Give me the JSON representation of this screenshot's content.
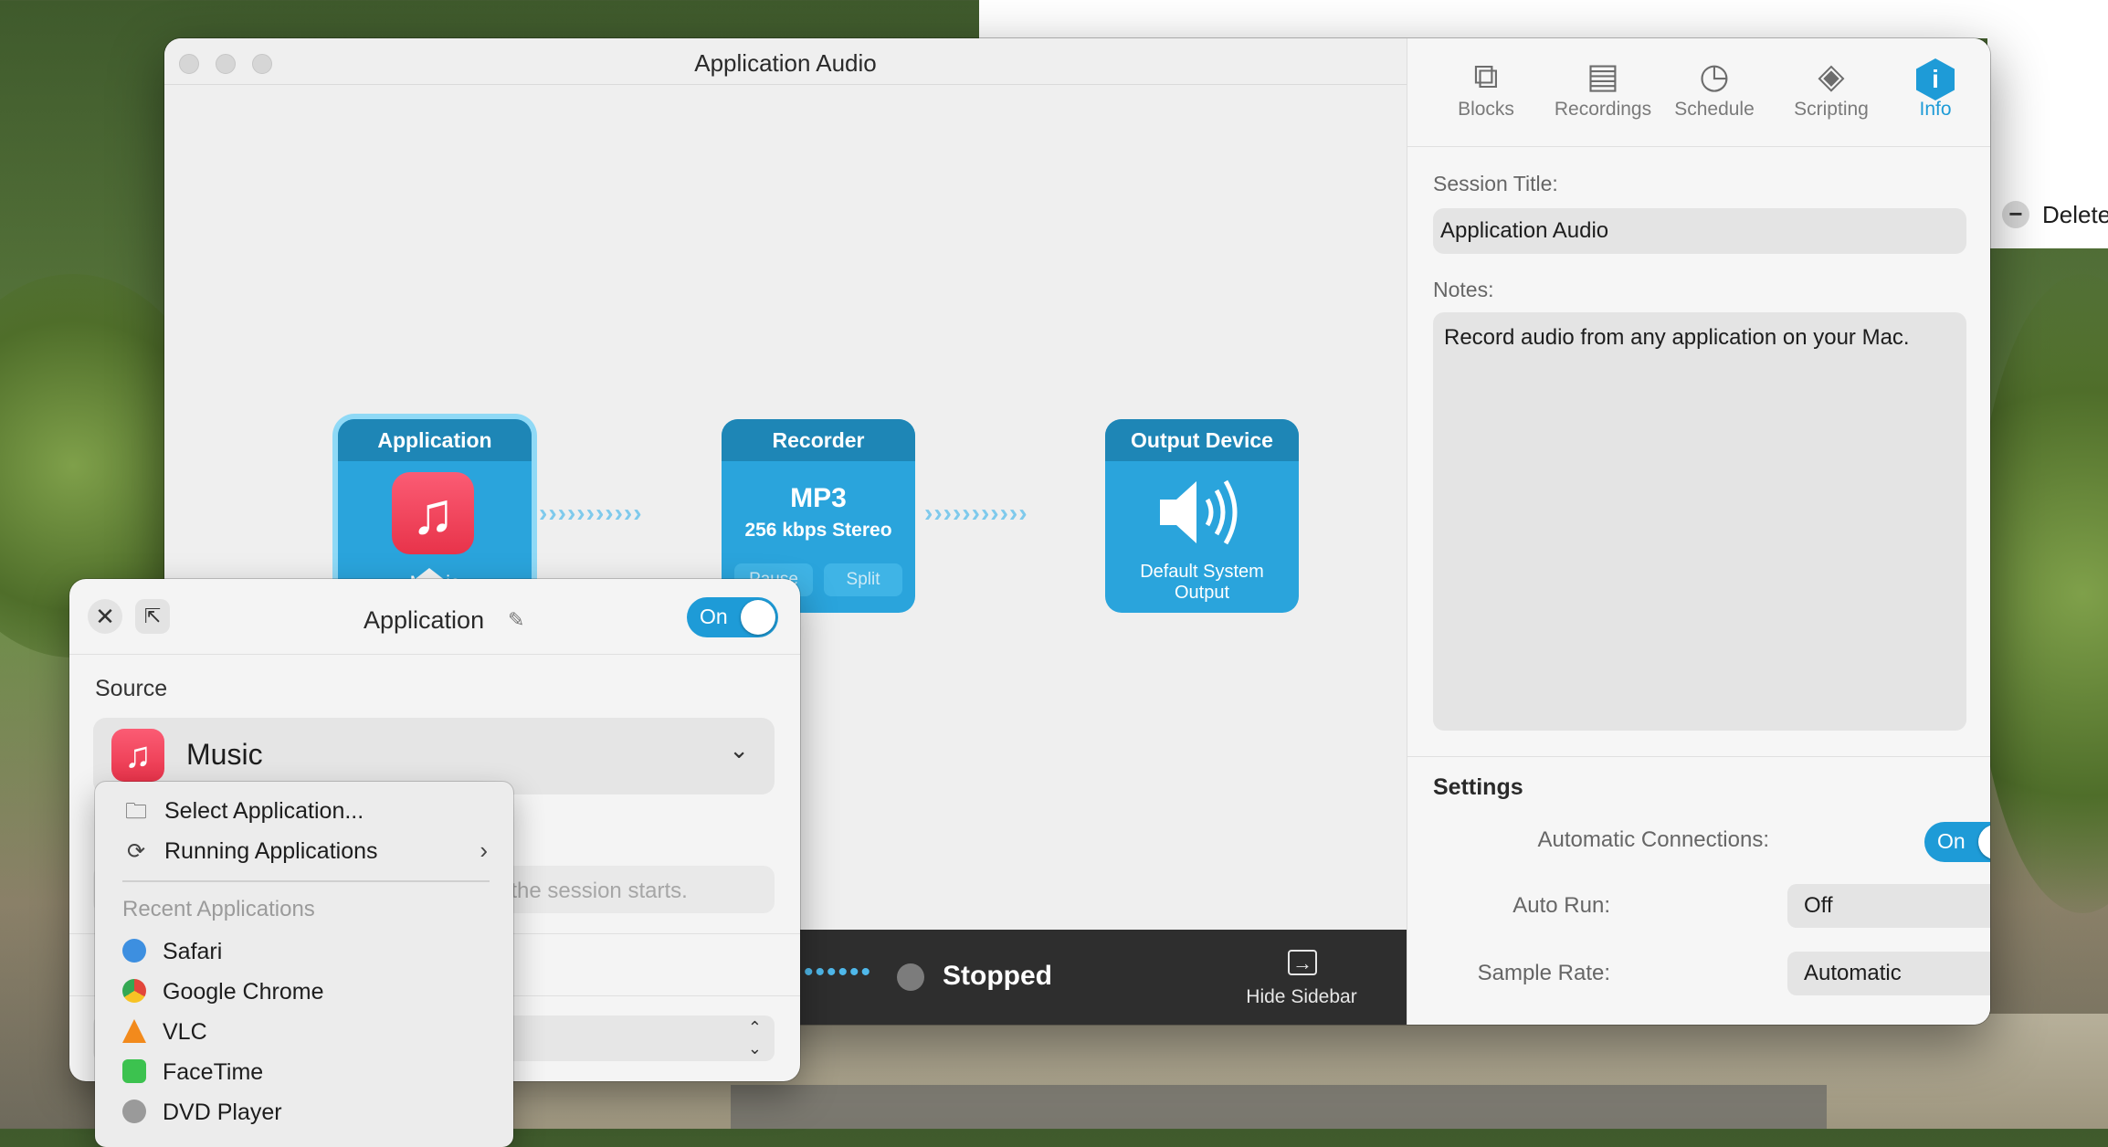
{
  "window": {
    "title": "Application Audio"
  },
  "canvas": {
    "blocks": {
      "application": {
        "header": "Application",
        "caption": "Music",
        "icon": "music-note-icon"
      },
      "recorder": {
        "header": "Recorder",
        "format": "MP3",
        "rate": "256 kbps Stereo",
        "pause_label": "Pause",
        "split_label": "Split"
      },
      "output": {
        "header": "Output Device",
        "caption": "Default System Output",
        "icon": "speaker-icon"
      }
    },
    "connector": "›››››››››››"
  },
  "statusbar": {
    "status": "Stopped",
    "hide_sidebar_label": "Hide Sidebar",
    "dots": "••••••"
  },
  "sidebar": {
    "tabs": [
      {
        "label": "Blocks",
        "icon": "blocks-icon"
      },
      {
        "label": "Recordings",
        "icon": "recordings-icon"
      },
      {
        "label": "Schedule",
        "icon": "clock-icon"
      },
      {
        "label": "Scripting",
        "icon": "scripting-icon"
      },
      {
        "label": "Info",
        "icon": "info-icon"
      }
    ],
    "active_tab": "Info",
    "session_title_label": "Session Title:",
    "session_title_value": "Application Audio",
    "notes_label": "Notes:",
    "notes_value": "Record audio from any application on your Mac.",
    "settings": {
      "title": "Settings",
      "automatic_connections_label": "Automatic Connections:",
      "automatic_connections_value": "On",
      "auto_run_label": "Auto Run:",
      "auto_run_value": "Off",
      "sample_rate_label": "Sample Rate:",
      "sample_rate_value": "Automatic"
    }
  },
  "popover": {
    "title": "Application",
    "toggle_label": "On",
    "source_label": "Source",
    "source_value": "Music",
    "hint_text": "en the session starts."
  },
  "menu": {
    "select_application": "Select Application...",
    "running_applications": "Running Applications",
    "recent_header": "Recent Applications",
    "recent_apps": [
      "Safari",
      "Google Chrome",
      "VLC",
      "FaceTime",
      "DVD Player"
    ],
    "app_colors": [
      "#3d8fe0",
      "#e2463b",
      "#f28a1c",
      "#3cc24f",
      "#9a9a9a"
    ]
  },
  "peek": {
    "label": "Delete"
  },
  "colors": {
    "accent": "#1e9bd7",
    "block": "#2aa4dc",
    "block_header": "#1e86b6",
    "status_bar": "#2e2e2e"
  }
}
